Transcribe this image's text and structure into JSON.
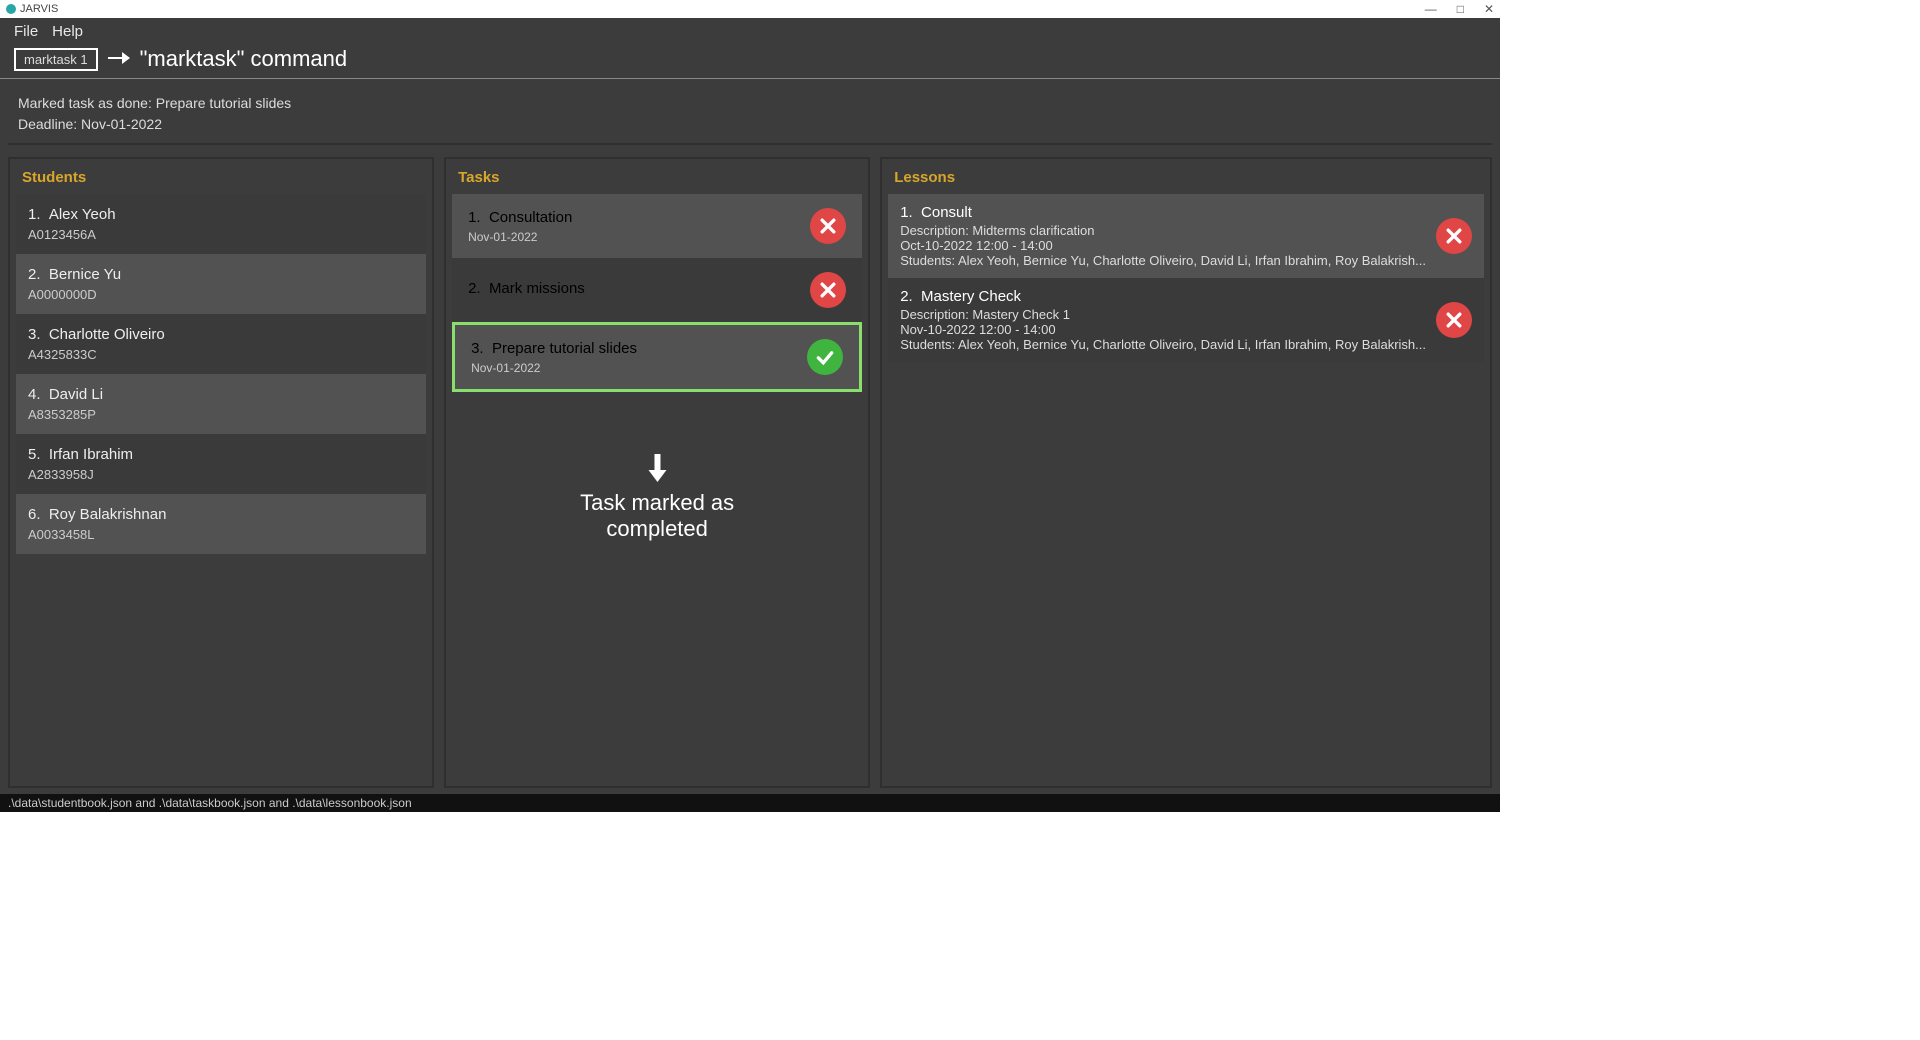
{
  "window": {
    "title": "JARVIS"
  },
  "menubar": {
    "file": "File",
    "help": "Help"
  },
  "command": {
    "input_value": "marktask 1",
    "annotation": "\"marktask\" command"
  },
  "result": {
    "line1": "Marked task as done: Prepare tutorial slides",
    "line2": "Deadline: Nov-01-2022"
  },
  "panels": {
    "students": {
      "header": "Students",
      "items": [
        {
          "idx": "1.",
          "name": "Alex Yeoh",
          "id": "A0123456A"
        },
        {
          "idx": "2.",
          "name": "Bernice Yu",
          "id": "A0000000D"
        },
        {
          "idx": "3.",
          "name": "Charlotte Oliveiro",
          "id": "A4325833C"
        },
        {
          "idx": "4.",
          "name": "David Li",
          "id": "A8353285P"
        },
        {
          "idx": "5.",
          "name": "Irfan Ibrahim",
          "id": "A2833958J"
        },
        {
          "idx": "6.",
          "name": "Roy Balakrishnan",
          "id": "A0033458L"
        }
      ]
    },
    "tasks": {
      "header": "Tasks",
      "items": [
        {
          "idx": "1.",
          "name": "Consultation",
          "date": "Nov-01-2022",
          "done": false
        },
        {
          "idx": "2.",
          "name": "Mark missions",
          "date": "",
          "done": false
        },
        {
          "idx": "3.",
          "name": "Prepare tutorial slides",
          "date": "Nov-01-2022",
          "done": true,
          "highlight": true
        }
      ],
      "annotation": "Task marked as completed"
    },
    "lessons": {
      "header": "Lessons",
      "items": [
        {
          "idx": "1.",
          "name": "Consult",
          "desc": "Description: Midterms clarification",
          "time": "Oct-10-2022 12:00 - 14:00",
          "students": "Students: Alex Yeoh, Bernice Yu, Charlotte Oliveiro, David Li, Irfan Ibrahim, Roy Balakrish..."
        },
        {
          "idx": "2.",
          "name": "Mastery Check",
          "desc": "Description: Mastery Check 1",
          "time": "Nov-10-2022 12:00 - 14:00",
          "students": "Students: Alex Yeoh, Bernice Yu, Charlotte Oliveiro, David Li, Irfan Ibrahim, Roy Balakrish..."
        }
      ]
    }
  },
  "statusbar": ".\\data\\studentbook.json and .\\data\\taskbook.json and .\\data\\lessonbook.json"
}
